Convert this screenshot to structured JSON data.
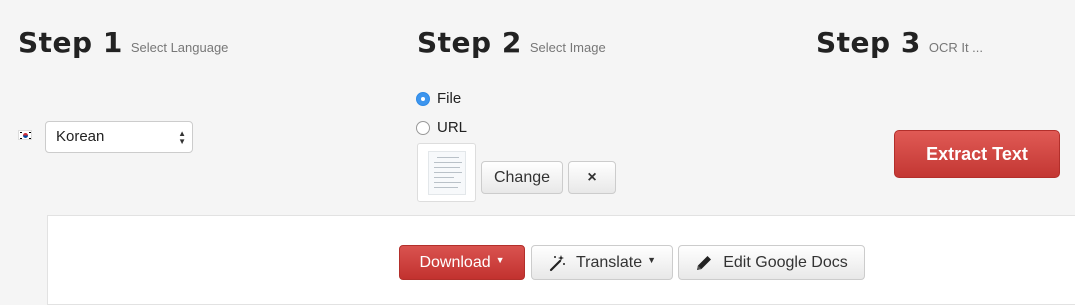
{
  "steps": [
    {
      "title": "Step 1",
      "subtitle": "Select Language"
    },
    {
      "title": "Step 2",
      "subtitle": "Select Image"
    },
    {
      "title": "Step 3",
      "subtitle": "OCR It ..."
    }
  ],
  "language": {
    "flag_icon": "korea-flag-icon",
    "selected": "Korean"
  },
  "source": {
    "options": [
      {
        "label": "File",
        "checked": true
      },
      {
        "label": "URL",
        "checked": false
      }
    ],
    "change_label": "Change",
    "remove_icon": "×"
  },
  "extract_label": "Extract Text",
  "actions": {
    "download_label": "Download",
    "translate_label": "Translate",
    "edit_gdocs_label": "Edit Google Docs"
  },
  "colors": {
    "accent_red": "#d9534f",
    "radio_blue": "#3d95ee"
  }
}
